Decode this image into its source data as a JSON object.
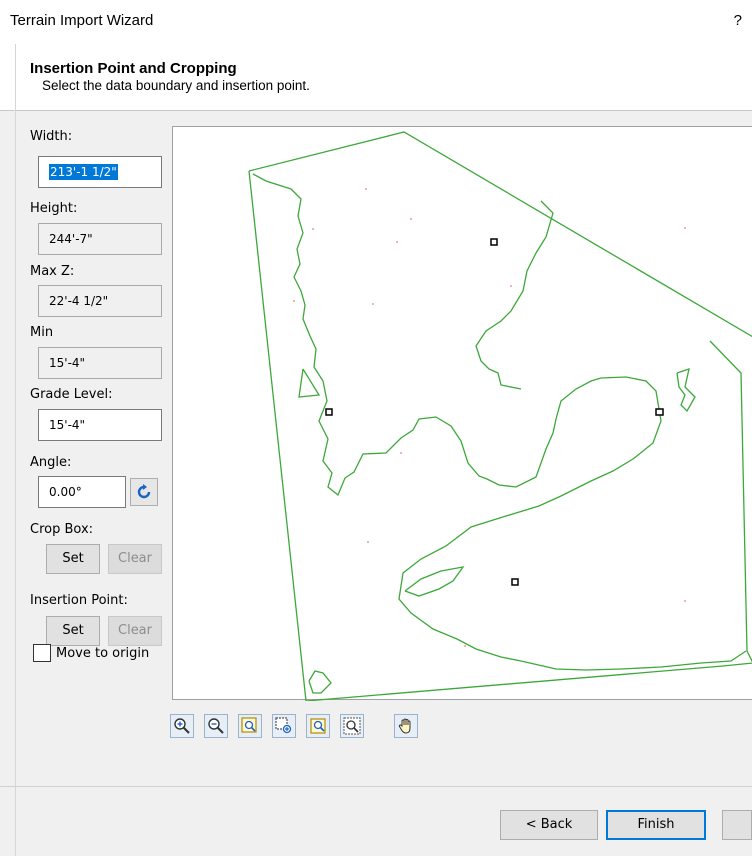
{
  "window": {
    "title": "Terrain Import Wizard",
    "help_label": "?"
  },
  "header": {
    "title": "Insertion Point and Cropping",
    "subtitle": "Select the data boundary and insertion point."
  },
  "fields": {
    "width": {
      "label": "Width:",
      "value": "213'-1 1/2\""
    },
    "height": {
      "label": "Height:",
      "value": "244'-7\""
    },
    "max_z": {
      "label": "Max Z:",
      "value": "22'-4 1/2\""
    },
    "min": {
      "label": "Min",
      "value": "15'-4\""
    },
    "grade_level": {
      "label": "Grade Level:",
      "value": "15'-4\""
    },
    "angle": {
      "label": "Angle:",
      "value": "0.00°"
    }
  },
  "crop_box": {
    "label": "Crop Box:",
    "set_label": "Set",
    "clear_label": "Clear"
  },
  "insertion_point": {
    "label": "Insertion Point:",
    "set_label": "Set",
    "clear_label": "Clear"
  },
  "move_to_origin": {
    "label": "Move to origin",
    "checked": false
  },
  "toolbar": {
    "icons": [
      "zoom-in-icon",
      "zoom-out-icon",
      "zoom-window-icon",
      "zoom-selection-icon",
      "zoom-extents-icon",
      "zoom-fit-icon",
      "pan-hand-icon"
    ]
  },
  "footer": {
    "back_label": "< Back",
    "finish_label": "Finish"
  },
  "colors": {
    "boundary": "#2ca02c",
    "selection": "#0078d7",
    "finish_border": "#0078d7"
  }
}
